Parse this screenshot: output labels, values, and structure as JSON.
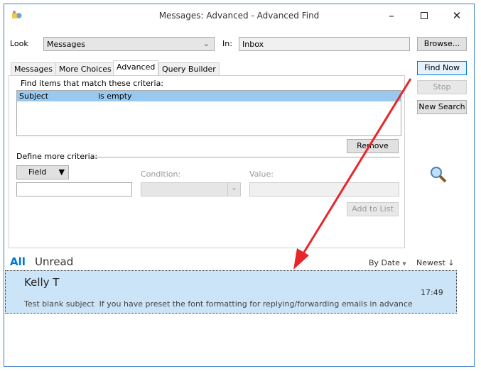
{
  "window": {
    "title": "Messages: Advanced - Advanced Find"
  },
  "look": {
    "label": "Look",
    "value": "Messages",
    "in_label": "In:",
    "in_value": "Inbox"
  },
  "buttons": {
    "browse": "Browse...",
    "find_now": "Find Now",
    "stop": "Stop",
    "new_search": "New Search",
    "remove": "Remove",
    "field": "Field",
    "add_to_list": "Add to List"
  },
  "tabs": [
    {
      "label": "Messages"
    },
    {
      "label": "More Choices"
    },
    {
      "label": "Advanced"
    },
    {
      "label": "Query Builder"
    }
  ],
  "advanced": {
    "criteria_label": "Find items that match these criteria:",
    "criteria": [
      {
        "field": "Subject",
        "condition": "is empty"
      }
    ],
    "define_label": "Define more criteria:",
    "condition_label": "Condition:",
    "value_label": "Value:"
  },
  "results": {
    "filter_all": "All",
    "filter_unread": "Unread",
    "sort_by": "By Date",
    "order": "Newest",
    "messages": [
      {
        "sender": "Kelly T",
        "time": "17:49",
        "subject": "Test blank subject",
        "preview": "If you have preset the font formatting for replying/forwarding emails in advance"
      }
    ]
  },
  "colors": {
    "accent": "#0078d7",
    "selection": "#99c9ef",
    "row": "#cce4f7",
    "arrow": "#e8262a"
  }
}
